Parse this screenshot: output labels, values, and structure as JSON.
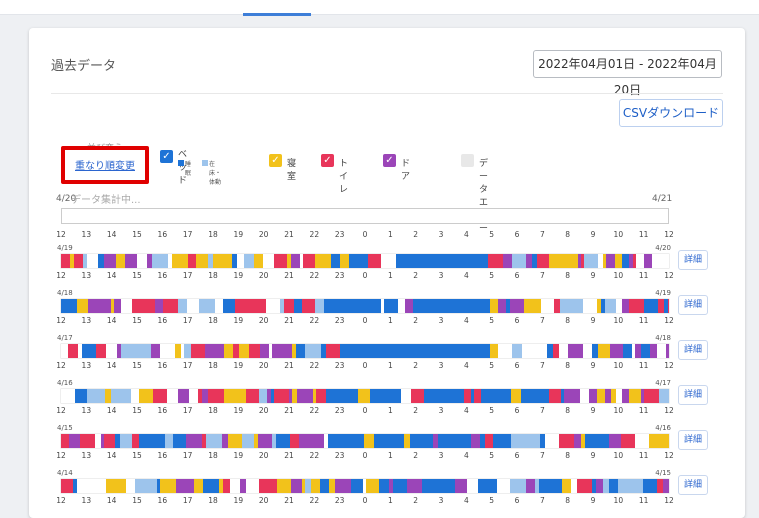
{
  "card": {
    "title": "過去データ",
    "date_range": "2022年04月01日 - 2022年04月20日",
    "csv_button": "CSVダウンロード"
  },
  "sort": {
    "header": "並び変え",
    "link": "重なり順変更"
  },
  "legend": {
    "bed": {
      "label": "ベッド",
      "sub_sleep": "睡眠",
      "sub_awake": "在床・体動",
      "color": "#1e73d6",
      "awake_color": "#9dc4ec"
    },
    "bedroom": {
      "label": "寝室",
      "color": "#f2c21b"
    },
    "toilet": {
      "label": "トイレ",
      "color": "#e8355a"
    },
    "door": {
      "label": "ドア",
      "color": "#9b45b8"
    },
    "error": {
      "label": "データエラー",
      "color": "#e8e8e8"
    }
  },
  "aggregate": {
    "start_date": "4/20",
    "end_date": "4/21",
    "status": "データ集計中..."
  },
  "detail_label": "詳細",
  "hour_ticks": [
    "12",
    "13",
    "14",
    "15",
    "16",
    "17",
    "18",
    "19",
    "20",
    "21",
    "22",
    "23",
    "0",
    "1",
    "2",
    "3",
    "4",
    "5",
    "6",
    "7",
    "8",
    "9",
    "10",
    "11",
    "12"
  ],
  "days": [
    {
      "start": "4/19",
      "end": "4/20"
    },
    {
      "start": "4/18",
      "end": "4/19"
    },
    {
      "start": "4/17",
      "end": "4/18"
    },
    {
      "start": "4/16",
      "end": "4/17"
    },
    {
      "start": "4/15",
      "end": "4/16"
    },
    {
      "start": "4/14",
      "end": "4/15"
    }
  ]
}
